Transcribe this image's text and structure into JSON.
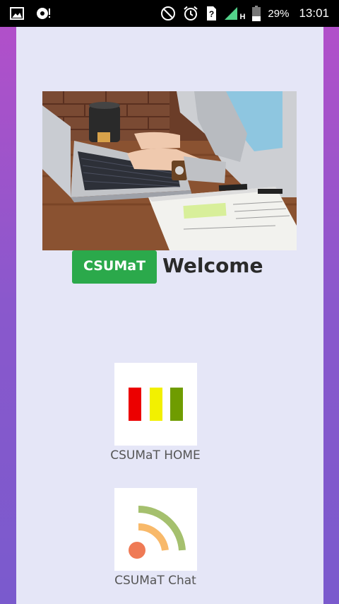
{
  "status_bar": {
    "battery": "29%",
    "time": "13:01",
    "network": "H",
    "icons": [
      "gallery-icon",
      "sync-icon",
      "do-not-disturb-icon",
      "alarm-icon",
      "sim-unknown-icon",
      "signal-icon",
      "battery-icon"
    ]
  },
  "hero": {
    "image": "laptop-typing-photo"
  },
  "welcome": {
    "brand": "CSUMaT",
    "text": "Welcome"
  },
  "apps": [
    {
      "label": "CSUMaT HOME",
      "icon": "bars-icon",
      "colors": [
        "#ec0000",
        "#f2f000",
        "#6f9c00"
      ]
    },
    {
      "label": "CSUMaT Chat",
      "icon": "rss-icon",
      "colors": [
        "#ef7a55",
        "#f8b96a",
        "#a5c06e"
      ]
    }
  ],
  "colors": {
    "brand_green": "#2ba94b",
    "panel_bg": "#e5e6f7"
  }
}
